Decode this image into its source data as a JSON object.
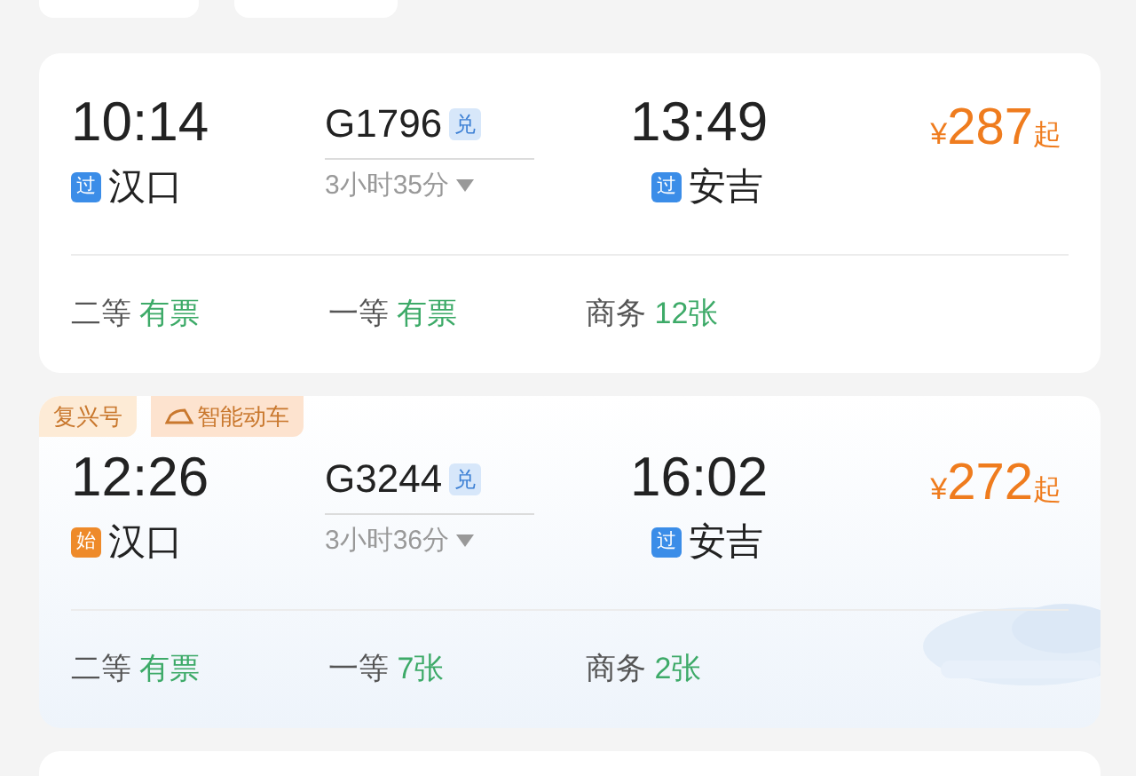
{
  "trains": [
    {
      "departure_time": "10:14",
      "departure_station": {
        "badge": "过",
        "kind": "pass",
        "name": "汉口"
      },
      "train_number": "G1796",
      "exchange_badge": "兑",
      "duration": "3小时35分",
      "arrival_time": "13:49",
      "arrival_station": {
        "badge": "过",
        "kind": "pass",
        "name": "安吉"
      },
      "price_symbol": "¥",
      "price": "287",
      "price_suffix": "起",
      "seats": [
        {
          "class": "二等",
          "availability": "有票"
        },
        {
          "class": "一等",
          "availability": "有票"
        },
        {
          "class": "商务",
          "availability": "12张"
        }
      ]
    },
    {
      "tags": [
        {
          "label": "复兴号",
          "kind": "plain"
        },
        {
          "label": "智能动车",
          "kind": "icon"
        }
      ],
      "departure_time": "12:26",
      "departure_station": {
        "badge": "始",
        "kind": "start",
        "name": "汉口"
      },
      "train_number": "G3244",
      "exchange_badge": "兑",
      "duration": "3小时36分",
      "arrival_time": "16:02",
      "arrival_station": {
        "badge": "过",
        "kind": "pass",
        "name": "安吉"
      },
      "price_symbol": "¥",
      "price": "272",
      "price_suffix": "起",
      "seats": [
        {
          "class": "二等",
          "availability": "有票"
        },
        {
          "class": "一等",
          "availability": "7张"
        },
        {
          "class": "商务",
          "availability": "2张"
        }
      ]
    }
  ]
}
